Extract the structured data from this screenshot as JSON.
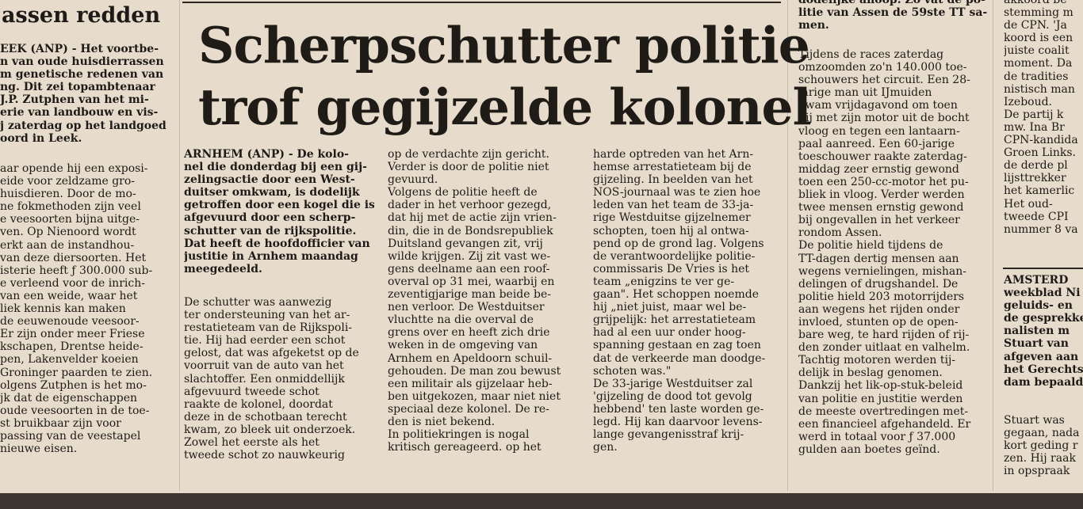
{
  "left_article": {
    "title": "assen redden",
    "lead": [
      "EEK (ANP) - Het voortbe-",
      "n van oude huisdierrassen",
      "m genetische redenen van",
      "ng. Dit zei topambtenaar",
      "J.P. Zutphen van het mi-",
      "erie van landbouw en vis-",
      "j zaterdag op het landgoed",
      "oord in Leek."
    ],
    "body": [
      "aar opende hij een exposi-",
      "eide voor zeldzame gro-",
      " huisdieren. Door de mo-",
      "ne fokmethoden zijn veel",
      "e veesoorten bijna uitge-",
      "ven. Op Nienoord wordt",
      "erkt aan de instandhou-",
      " van deze diersoorten. Het",
      "isterie heeft ƒ 300.000 sub-",
      "e verleend voor de inrich-",
      " van een weide, waar het",
      "liek kennis kan maken",
      " de eeuwenoude veesoor-",
      " Er zijn onder meer Friese",
      "kschapen, Drentse heide-",
      "pen, Lakenvelder koeien",
      "Groninger paarden te zien.",
      "olgens Zutphen is het mo-",
      "jk dat de eigenschappen",
      "oude veesoorten in de toe-",
      "st bruikbaar zijn voor",
      "passing van de veestapel",
      " nieuwe eisen."
    ]
  },
  "main_article": {
    "headline_line1": "Scherpschutter politie",
    "headline_line2": "trof gegijzelde kolonel",
    "col1": {
      "lead": [
        "ARNHEM (ANP) - De kolo-",
        "nel die donderdag bij een gij-",
        "zelingsactie door een West-",
        "duitser omkwam, is dodelijk",
        "getroffen door een kogel die is",
        "afgevuurd door een scherp-",
        "schutter van de rijkspolitie.",
        "Dat heeft de hoofdofficier van",
        "justitie in Arnhem maandag",
        "meegedeeld."
      ],
      "body": [
        "De schutter was aanwezig",
        "ter ondersteuning van het ar-",
        "restatieteam van de Rijkspoli-",
        "tie. Hij had eerder een schot",
        "gelost, dat was afgeketst op de",
        "voorruit van de auto van het",
        "slachtoffer. Een onmiddellijk",
        "afgevuurd tweede schot",
        "raakte de kolonel, doordat",
        "deze in de schotbaan terecht",
        "kwam, zo bleek uit onderzoek.",
        "Zowel het eerste als het",
        "tweede schot zo nauwkeurig"
      ]
    },
    "col2": [
      "op de verdachte zijn gericht.",
      "Verder is door de politie niet",
      "gevuurd.",
      "Volgens de politie heeft de",
      "dader in het verhoor gezegd,",
      "dat hij met de actie zijn vrien-",
      "din, die in de Bondsrepubliek",
      "Duitsland gevangen zit, vrij",
      "wilde krijgen. Zij zit vast we-",
      "gens deelname aan een roof-",
      "overval op 31 mei, waarbij en",
      "zeventigjarige man beide be-",
      "nen verloor. De Westduitser",
      "vluchtte na die overval de",
      "grens over en heeft zich drie",
      "weken in de omgeving van",
      "Arnhem en Apeldoorn schuil-",
      "gehouden. De man zou bewust",
      "een militair als gijzelaar heb-",
      "ben uitgekozen, maar niet niet",
      "speciaal deze kolonel. De re-",
      "den is niet bekend.",
      "In politiekringen is nogal",
      "kritisch gereageerd. op het"
    ],
    "col3": [
      "harde optreden van het Arn-",
      "hemse arrestatieteam bij de",
      "gijzeling. In beelden van het",
      "NOS-journaal was te zien hoe",
      "leden van het team de 33-ja-",
      "rige Westduitse gijzelnemer",
      "schopten, toen hij al ontwa-",
      "pend op de grond lag. Volgens",
      "de verantwoordelijke politie-",
      "commissaris De Vries is het",
      "team „enigzins te ver ge-",
      "gaan\". Het schoppen noemde",
      "hij „niet juist, maar wel be-",
      "grijpelijk: het arrestatieteam",
      "had al een uur onder hoog-",
      "spanning gestaan en zag toen",
      "dat de verkeerde man doodge-",
      "schoten was.\"",
      "De 33-jarige Westduitser zal",
      "'gijzeling de dood tot gevolg",
      "hebbend' ten laste worden ge-",
      "legd. Hij kan daarvoor levens-",
      "lange gevangenisstraf krij-",
      "gen."
    ]
  },
  "tt_article": {
    "top_lines": [
      "dodelijke afloop. Zo vat de po-",
      "litie van Assen de 59ste TT sa-",
      "men."
    ],
    "body": [
      "Tijdens de races zaterdag",
      "omzoomden zo'n 140.000 toe-",
      "schouwers het circuit. Een 28-",
      "jarige man uit IJmuiden",
      "kwam vrijdagavond om toen",
      "hij met zijn motor uit de bocht",
      "vloog en tegen een lantaarn-",
      "paal aanreed. Een 60-jarige",
      "toeschouwer raakte zaterdag-",
      "middag zeer ernstig gewond",
      "toen een 250-cc-motor het pu-",
      "bliek in vloog. Verder werden",
      "twee mensen ernstig gewond",
      "bij ongevallen in het verkeer",
      "rondom Assen.",
      "De politie hield tijdens de",
      "TT-dagen dertig mensen aan",
      "wegens vernielingen, mishan-",
      "delingen of drugshandel. De",
      "politie hield 203 motorrijders",
      "aan wegens het rijden onder",
      "invloed, stunten op de open-",
      "bare weg, te hard rijden of rij-",
      "den zonder uitlaat en valhelm.",
      "Tachtig motoren werden tij-",
      "delijk in beslag genomen.",
      "Dankzij het lik-op-stuk-beleid",
      "van politie en justitie werden",
      "de meeste overtredingen met-",
      "een financieel afgehandeld. Er",
      "werd in totaal voor ƒ 37.000",
      "gulden aan boetes geïnd."
    ]
  },
  "right_article": {
    "top_lines": [
      "akkoord be",
      "stemming m",
      "de CPN. 'Ja",
      "koord is een",
      "juiste coalit",
      "moment. Da",
      "de tradities",
      "nistisch man",
      "Izeboud.",
      "De partij k",
      "mw. Ina Br",
      "CPN-kandida",
      "Groen Links.",
      "de derde pl",
      "lijsttrekker",
      "het kamerlic",
      "Het oud-",
      "tweede CPI",
      "nummer 8 va"
    ],
    "lead": [
      "AMSTERD",
      "weekblad Ni",
      "geluids- en",
      "de gesprekke",
      "nalisten m",
      "Stuart van",
      "afgeven aan",
      "het Gerechts",
      "dam bepaald"
    ],
    "bottom_lines": [
      "Stuart was",
      "gegaan, nada",
      "kort geding r",
      "zen. Hij raak",
      "in opspraak"
    ]
  }
}
